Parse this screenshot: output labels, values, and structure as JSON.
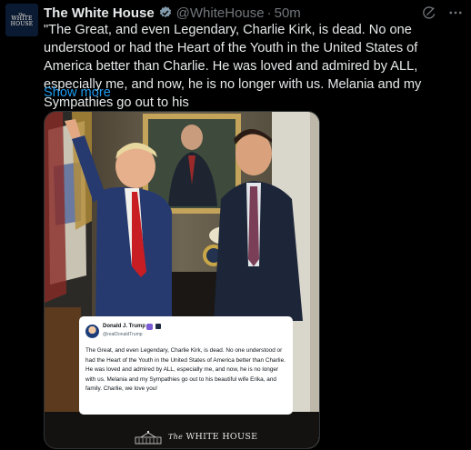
{
  "account": {
    "avatar_line1": "The",
    "avatar_line2": "WHITE",
    "avatar_line3": "HOUSE",
    "name": "The White House",
    "handle": "@WhiteHouse",
    "separator": "·",
    "time": "50m",
    "verified_icon": "verified-badge-icon"
  },
  "tweet": {
    "text": "\"The Great, and even Legendary, Charlie Kirk, is dead. No one understood or had the Heart of the Youth in the United States of America better than Charlie. He was loved and admired by ALL, especially me, and now, he is no longer with us. Melania and my Sympathies go out to his",
    "show_more": "Show more"
  },
  "embedded_post": {
    "name": "Donald J. Trump",
    "handle": "@realDonaldTrump",
    "text": "The Great, and even Legendary, Charlie Kirk, is dead. No one understood or had the Heart of the Youth in the United States of America better than Charlie. He was loved and admired by ALL, especially me, and now, he is no longer with us. Melania and my Sympathies go out to his beautiful wife Erika, and family. Charlie, we love you!"
  },
  "watermark": {
    "the": "The",
    "name": "WHITE HOUSE"
  },
  "colors": {
    "link": "#1d9bf0",
    "verified": "#829aab",
    "background": "#000000"
  }
}
